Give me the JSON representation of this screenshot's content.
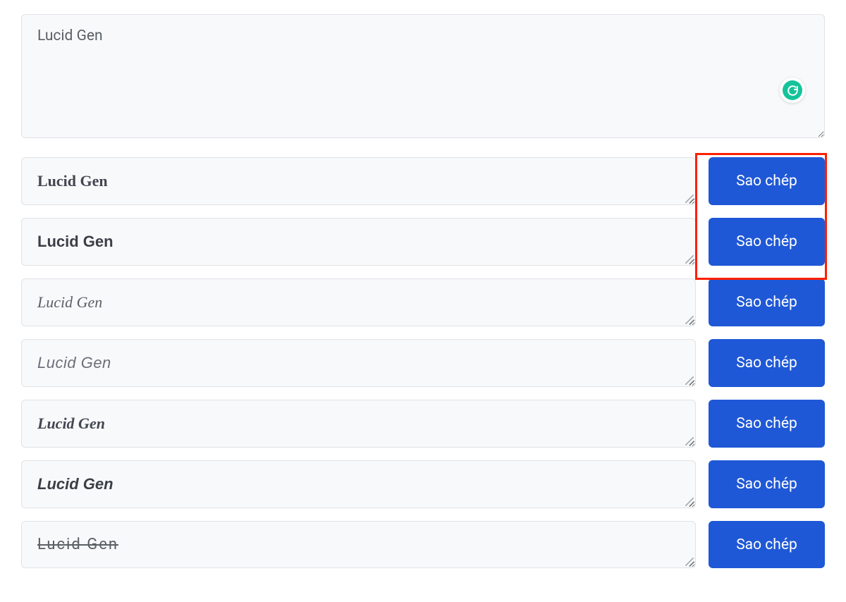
{
  "input": {
    "value": "Lucid Gen"
  },
  "copy_label": "Sao chép",
  "rows": [
    {
      "text": "Lucid Gen",
      "style": "f-bold-serif"
    },
    {
      "text": "Lucid Gen",
      "style": "f-bold-sans"
    },
    {
      "text": "Lucid Gen",
      "style": "f-italic-serif"
    },
    {
      "text": "Lucid Gen",
      "style": "f-italic-sans"
    },
    {
      "text": "Lucid Gen",
      "style": "f-bolditalic-serif"
    },
    {
      "text": "Lucid Gen",
      "style": "f-bolditalic-sans"
    },
    {
      "text": "Lucid Gen",
      "style": "f-strike"
    }
  ]
}
